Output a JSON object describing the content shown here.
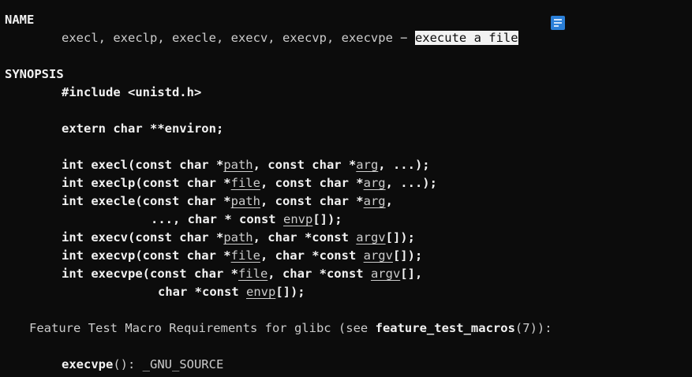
{
  "sections": {
    "name_header": "NAME",
    "synopsis_header": "SYNOPSIS"
  },
  "name": {
    "functions": "execl, execlp, execle, execv, execvp, execvpe",
    "dash": " − ",
    "description": "execute a file"
  },
  "synopsis": {
    "include": "#include <unistd.h>",
    "environ": "extern char **environ;",
    "execl": {
      "pre": "int execl(const char *",
      "p1": "path",
      "mid1": ", const char *",
      "p2": "arg",
      "post": ", ...);"
    },
    "execlp": {
      "pre": "int execlp(const char *",
      "p1": "file",
      "mid1": ", const char *",
      "p2": "arg",
      "post": ", ...);"
    },
    "execle": {
      "pre": "int execle(const char *",
      "p1": "path",
      "mid1": ", const char *",
      "p2": "arg",
      "post": ","
    },
    "execle_cont": {
      "pre": "..., char * const ",
      "p1": "envp",
      "post": "[]);"
    },
    "execv": {
      "pre": "int execv(const char *",
      "p1": "path",
      "mid1": ", char *const ",
      "p2": "argv",
      "post": "[]);"
    },
    "execvp": {
      "pre": "int execvp(const char *",
      "p1": "file",
      "mid1": ", char *const ",
      "p2": "argv",
      "post": "[]);"
    },
    "execvpe": {
      "pre": "int execvpe(const char *",
      "p1": "file",
      "mid1": ", char *const ",
      "p2": "argv",
      "post": "[],"
    },
    "execvpe_cont": {
      "pre": "char *const ",
      "p1": "envp",
      "post": "[]);"
    }
  },
  "feature": {
    "pre": "Feature Test Macro Requirements for glibc (see ",
    "bold": "feature_test_macros",
    "post": "(7)):"
  },
  "execvpe_macro": {
    "bold": "execvpe",
    "post": "(): _GNU_SOURCE"
  },
  "colors": {
    "background": "#0c0c0c",
    "text": "#cccccc",
    "bold_text": "#f2f2f2",
    "selection": "#f2f2f2",
    "icon": "#2b7fd8"
  },
  "icons": {
    "overlay": "notes-icon"
  }
}
